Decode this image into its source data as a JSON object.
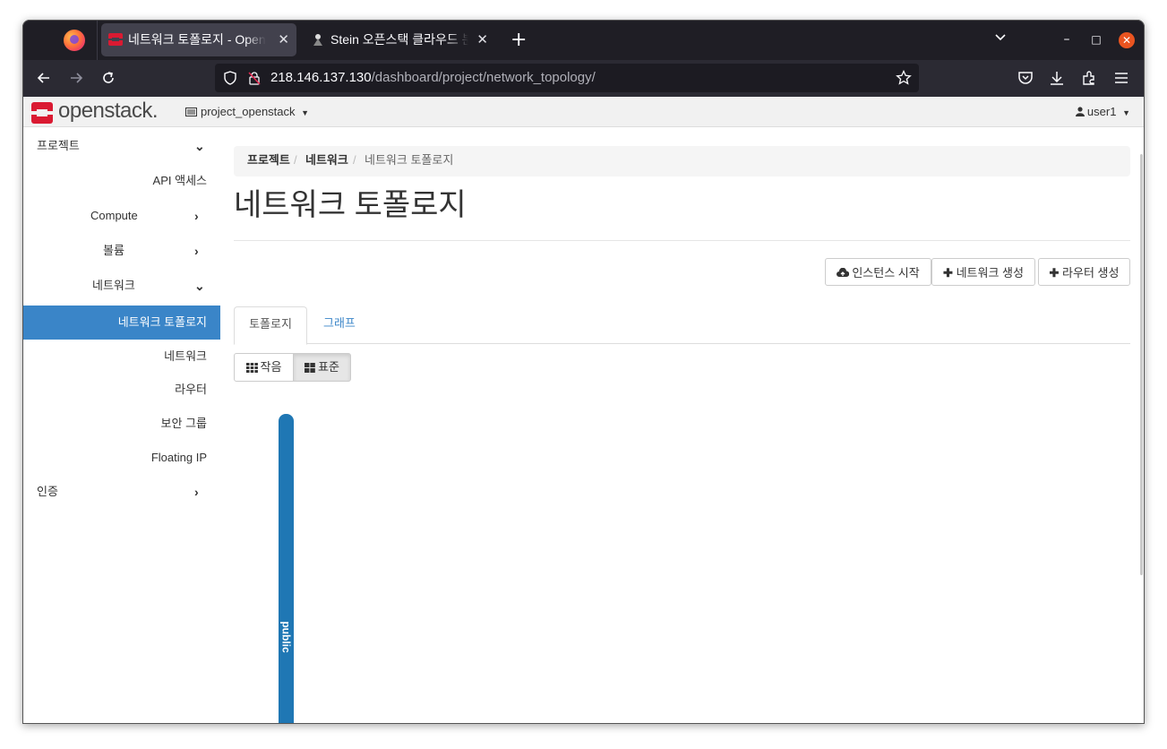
{
  "browser": {
    "tabs": [
      {
        "title": "네트워크 토폴로지 - OpenStack Dashboard",
        "active": true
      },
      {
        "title": "Stein 오픈스택 클라우드 분석",
        "active": false
      }
    ],
    "url_host": "218.146.137.130",
    "url_path": "/dashboard/project/network_topology/",
    "new_tab": "+",
    "close_glyph": "✕",
    "minimize_glyph": "–",
    "maximize_glyph": "□"
  },
  "header": {
    "logo": "openstack.",
    "project": "project_openstack",
    "user": "user1"
  },
  "sidebar": {
    "items": [
      {
        "label": "프로젝트"
      },
      {
        "label": "API 액세스"
      },
      {
        "label": "Compute"
      },
      {
        "label": "볼륨"
      },
      {
        "label": "네트워크"
      },
      {
        "label": "네트워크 토폴로지"
      },
      {
        "label": "네트워크"
      },
      {
        "label": "라우터"
      },
      {
        "label": "보안 그룹"
      },
      {
        "label": "Floating IP"
      },
      {
        "label": "인증"
      }
    ]
  },
  "main": {
    "breadcrumb": [
      "프로젝트",
      "네트워크",
      "네트워크 토폴로지"
    ],
    "breadcrumb_sep": "/",
    "title": "네트워크 토폴로지",
    "actions": {
      "launch_instance": "인스턴스 시작",
      "create_network": "네트워크 생성",
      "create_router": "라우터 생성"
    },
    "tabs": [
      "토폴로지",
      "그래프"
    ],
    "view_modes": [
      "작음",
      "표준"
    ],
    "network_label": "public"
  },
  "colors": {
    "accent": "#3a85c8",
    "network_bar": "#1f77b4",
    "os_red": "#da1a32"
  }
}
